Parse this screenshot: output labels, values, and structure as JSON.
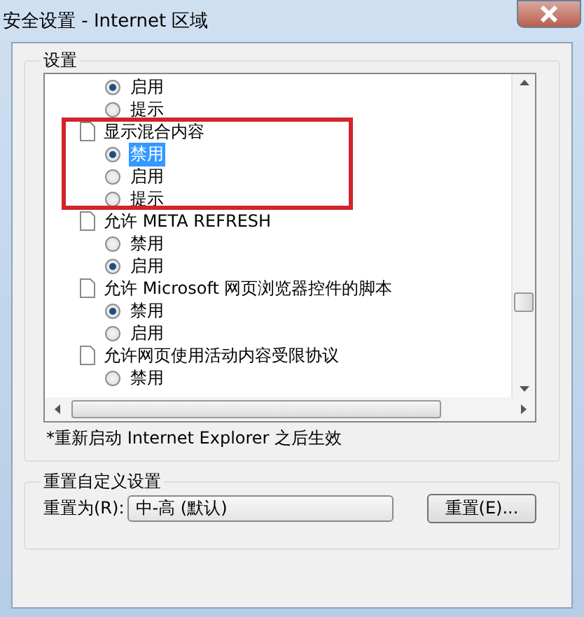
{
  "window": {
    "title": "安全设置 - Internet 区域"
  },
  "settings_group": {
    "label": "设置",
    "tree": [
      {
        "children": [
          {
            "label": "启用",
            "checked": true,
            "selected": false
          },
          {
            "label": "提示",
            "checked": false,
            "selected": false
          }
        ]
      },
      {
        "label": "显示混合内容",
        "children": [
          {
            "label": "禁用",
            "checked": true,
            "selected": true
          },
          {
            "label": "启用",
            "checked": false,
            "selected": false
          },
          {
            "label": "提示",
            "checked": false,
            "selected": false
          }
        ]
      },
      {
        "label": "允许 META REFRESH",
        "children": [
          {
            "label": "禁用",
            "checked": false,
            "selected": false
          },
          {
            "label": "启用",
            "checked": true,
            "selected": false
          }
        ]
      },
      {
        "label": "允许 Microsoft 网页浏览器控件的脚本",
        "children": [
          {
            "label": "禁用",
            "checked": true,
            "selected": false
          },
          {
            "label": "启用",
            "checked": false,
            "selected": false
          }
        ]
      },
      {
        "label": "允许网页使用活动内容受限协议",
        "children": [
          {
            "label": "禁用",
            "checked": false,
            "selected": false
          }
        ]
      }
    ],
    "note": "*重新启动 Internet Explorer 之后生效"
  },
  "reset_group": {
    "label": "重置自定义设置",
    "field_label": "重置为(R):",
    "value": "中-高 (默认)",
    "button": "重置(E)..."
  }
}
